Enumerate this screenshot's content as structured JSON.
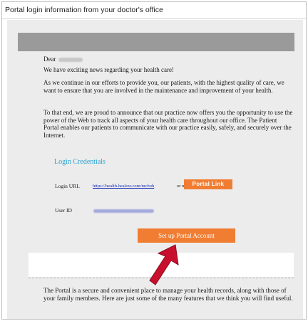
{
  "subject": "Portal login information from your doctor's office",
  "email": {
    "greeting": "Dear",
    "paragraph1": "We have exciting news regarding your health care!",
    "paragraph2": "As we continue in our efforts to provide you, our patients, with the highest quality of care, we want to ensure that you are involved in the maintenance and improvement of your health.",
    "paragraph3": "To that end, we are proud to announce that our practice now offers you the opportunity to use the power of the Web to track all aspects of your health care throughout our office. The Patient Portal enables our patients to communicate with our practice easily, safely, and securely over the Internet.",
    "credentials_title": "Login Credentials",
    "login_url_label": "Login URL",
    "login_url": "https://health.healow.com/mcboh",
    "or_use": "or use",
    "portal_link_button": "Portal Link",
    "user_id_label": "User ID",
    "setup_button": "Set up Portal Account",
    "paragraph4": "The Portal is a secure and convenient place to manage your health records, along with those of your family members. Here are just some of the many features that we think you will find useful."
  },
  "colors": {
    "accent_orange": "#f07d32",
    "credentials_blue": "#2aa0cf",
    "arrow_red": "#c8102e",
    "header_gray": "#9a9a9a"
  }
}
